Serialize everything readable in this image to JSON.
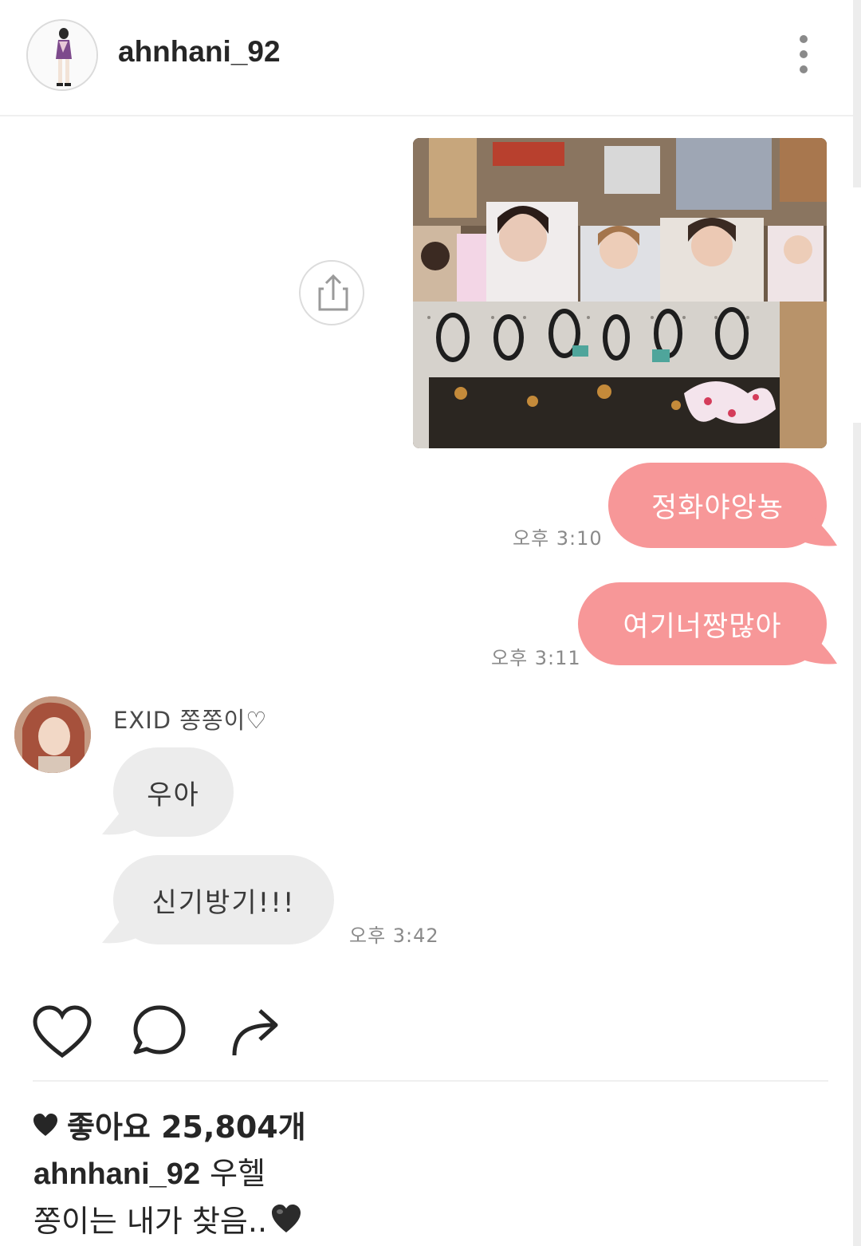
{
  "header": {
    "username": "ahnhani_92"
  },
  "chat": {
    "outgoing": [
      {
        "text": "정화야앙뇽",
        "time": "오후 3:10"
      },
      {
        "text": "여기너짱많아",
        "time": "오후 3:11"
      }
    ],
    "friend": {
      "name": "EXID 쫑쫑이♡",
      "messages": [
        {
          "text": "우아"
        },
        {
          "text": "신기방기!!!"
        }
      ],
      "last_time": "오후 3:42"
    }
  },
  "post": {
    "likes_label": "좋아요 25,804개",
    "caption_user": "ahnhani_92",
    "caption_text": "우헬",
    "caption_line2": "쫑이는 내가 찾음.."
  },
  "colors": {
    "outgoing_bubble": "#f79798",
    "incoming_bubble": "#ececec"
  },
  "icons": [
    "more-vert-icon",
    "share-icon",
    "heart-icon",
    "comment-icon",
    "send-icon",
    "heart-filled-icon",
    "black-heart-emoji"
  ]
}
